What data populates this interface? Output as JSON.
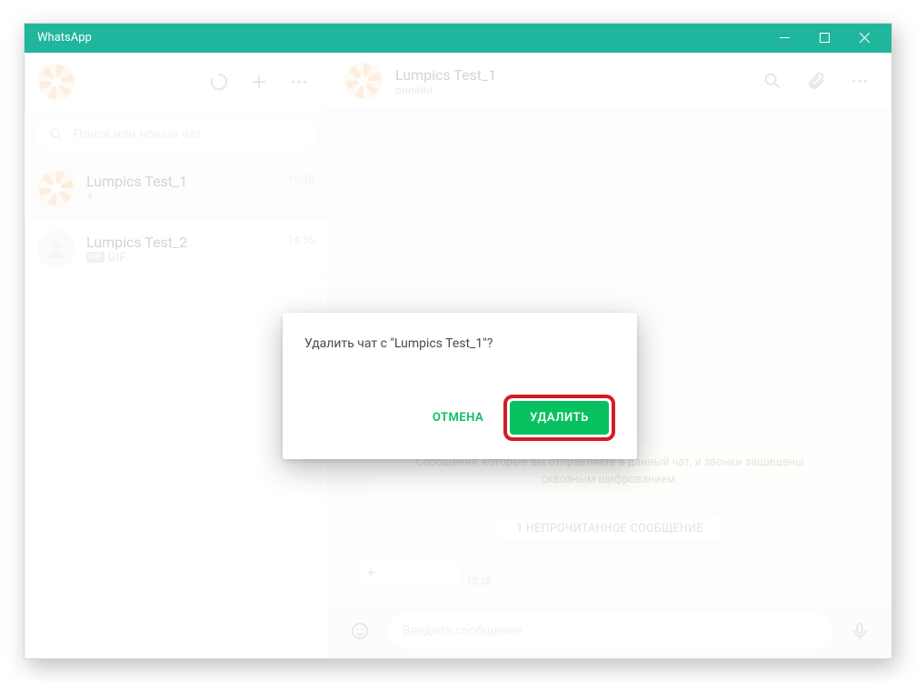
{
  "window": {
    "title": "WhatsApp"
  },
  "sidebar_header": {
    "refresh_name": "refresh-icon",
    "new_chat_name": "plus-icon",
    "menu_name": "more-icon"
  },
  "search": {
    "placeholder": "Поиск или новый чат"
  },
  "chats": [
    {
      "name": "Lumpics Test_1",
      "preview_plus": "+",
      "time": "15:38",
      "active": true,
      "avatar": "orange"
    },
    {
      "name": "Lumpics Test_2",
      "gif_badge": "GIF",
      "preview": "GIF",
      "time": "14:36",
      "active": false,
      "avatar": "generic"
    }
  ],
  "conversation": {
    "contact_name": "Lumpics Test_1",
    "contact_status": "онлайн",
    "encryption_text": "Сообщения, которые вы отправляете в данный чат, и звонки защищены сквозным шифрованием.",
    "unread_text": "1 НЕПРОЧИТАННОЕ СООБЩЕНИЕ",
    "message_time": "15:38",
    "composer_placeholder": "Введите сообщение"
  },
  "modal": {
    "text": "Удалить чат с \"Lumpics Test_1\"?",
    "cancel_label": "ОТМЕНА",
    "delete_label": "УДАЛИТЬ"
  }
}
